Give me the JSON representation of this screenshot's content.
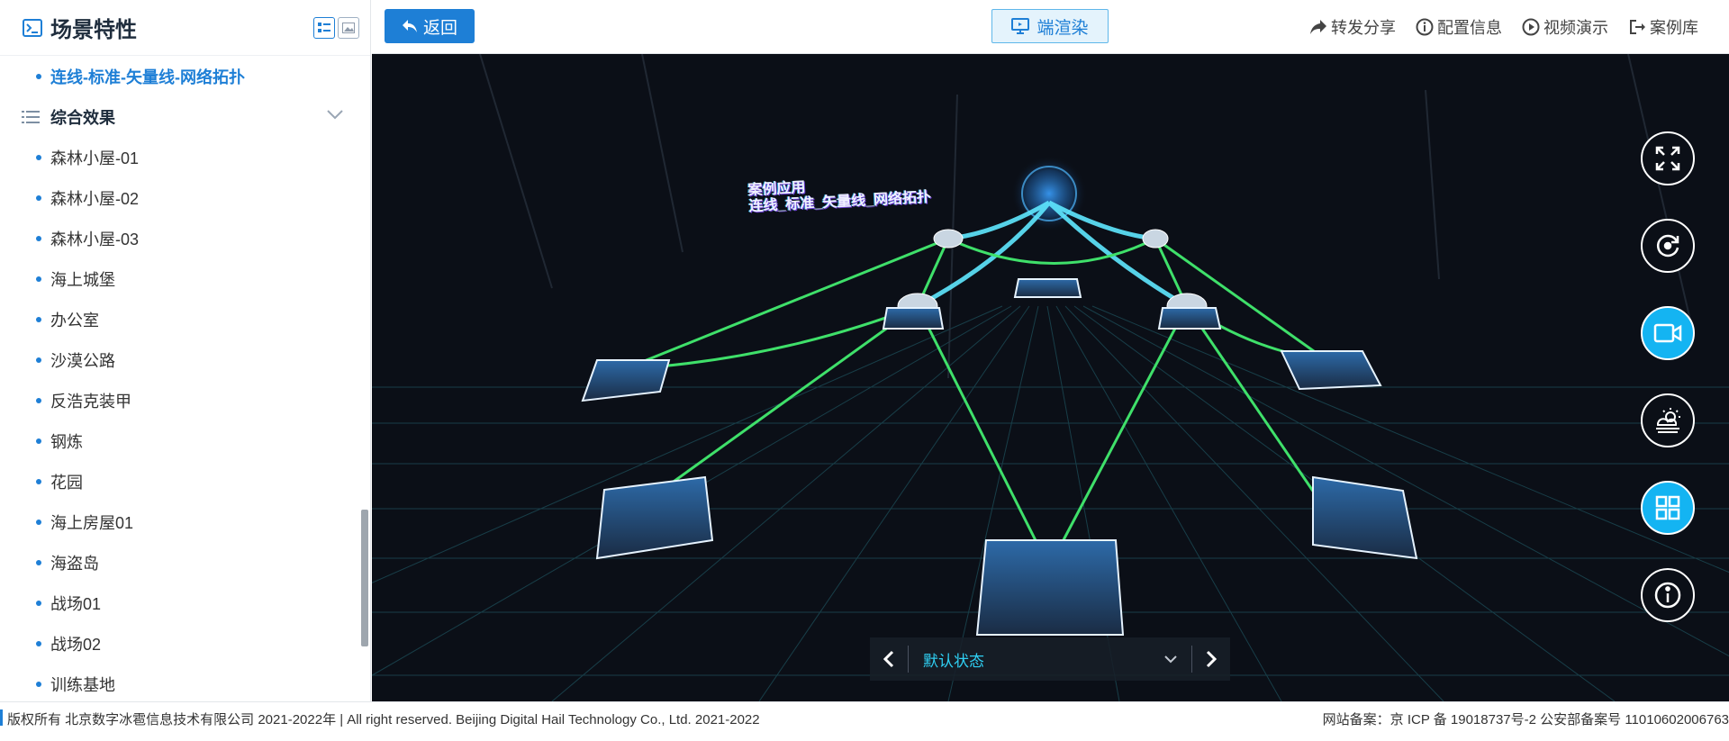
{
  "sidebar": {
    "title": "场景特性",
    "items": [
      {
        "type": "item",
        "label": "连线-标准-矢量线-网络拓扑",
        "active": true
      },
      {
        "type": "group",
        "label": "综合效果"
      },
      {
        "type": "item",
        "label": "森林小屋-01"
      },
      {
        "type": "item",
        "label": "森林小屋-02"
      },
      {
        "type": "item",
        "label": "森林小屋-03"
      },
      {
        "type": "item",
        "label": "海上城堡"
      },
      {
        "type": "item",
        "label": "办公室"
      },
      {
        "type": "item",
        "label": "沙漠公路"
      },
      {
        "type": "item",
        "label": "反浩克装甲"
      },
      {
        "type": "item",
        "label": "钢炼"
      },
      {
        "type": "item",
        "label": "花园"
      },
      {
        "type": "item",
        "label": "海上房屋01"
      },
      {
        "type": "item",
        "label": "海盗岛"
      },
      {
        "type": "item",
        "label": "战场01"
      },
      {
        "type": "item",
        "label": "战场02"
      },
      {
        "type": "item",
        "label": "训练基地"
      }
    ]
  },
  "topbar": {
    "back_label": "返回",
    "render_label": "端渲染",
    "actions": {
      "share": "转发分享",
      "config": "配置信息",
      "video": "视频演示",
      "cases": "案例库"
    }
  },
  "viewport": {
    "scene_label_line1": "案例应用",
    "scene_label_line2": "连线_标准_矢量线_网络拓扑",
    "state_select": "默认状态"
  },
  "footer": {
    "copyright": "版权所有 北京数字冰雹信息技术有限公司 2021-2022年 | All right reserved. Beijing Digital Hail Technology Co., Ltd. 2021-2022",
    "icp": "网站备案：京 ICP 备 19018737号-2 公安部备案号 11010602006763"
  },
  "colors": {
    "accent": "#1e7fd6",
    "viewport_bg": "#0b0f17",
    "link_green": "#3fe06a",
    "link_cyan": "#5fe8ff",
    "control_blue": "#14b4f2"
  },
  "icons": [
    "terminal-icon",
    "list-view-icon",
    "image-view-icon",
    "list-icon",
    "chevron-down-icon",
    "chevron-left-icon",
    "undo-arrow-icon",
    "monitor-icon",
    "share-icon",
    "info-icon",
    "play-icon",
    "exit-icon",
    "fullscreen-icon",
    "rotate-icon",
    "camera-icon",
    "weather-icon",
    "grid-icon"
  ]
}
